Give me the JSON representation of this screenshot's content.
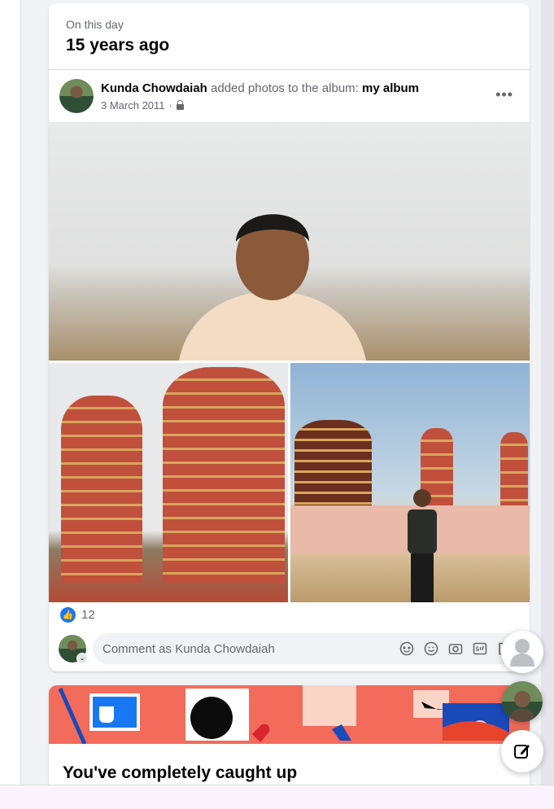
{
  "memory": {
    "label": "On this day",
    "title": "15 years ago"
  },
  "post": {
    "author": "Kunda Chowdaiah",
    "action": "added photos to the album:",
    "album": "my album",
    "date": "3 March 2011",
    "separator": "·",
    "more": "•••"
  },
  "reactions": {
    "count": "12"
  },
  "comment": {
    "placeholder": "Comment as Kunda Chowdaiah",
    "icons": [
      "avatar-sticker-icon",
      "emoji-icon",
      "camera-icon",
      "gif-icon",
      "sticker-icon"
    ]
  },
  "caught_up": {
    "title": "You've completely caught up"
  },
  "colors": {
    "accent": "#1877f2",
    "banner": "#f26b5b"
  }
}
